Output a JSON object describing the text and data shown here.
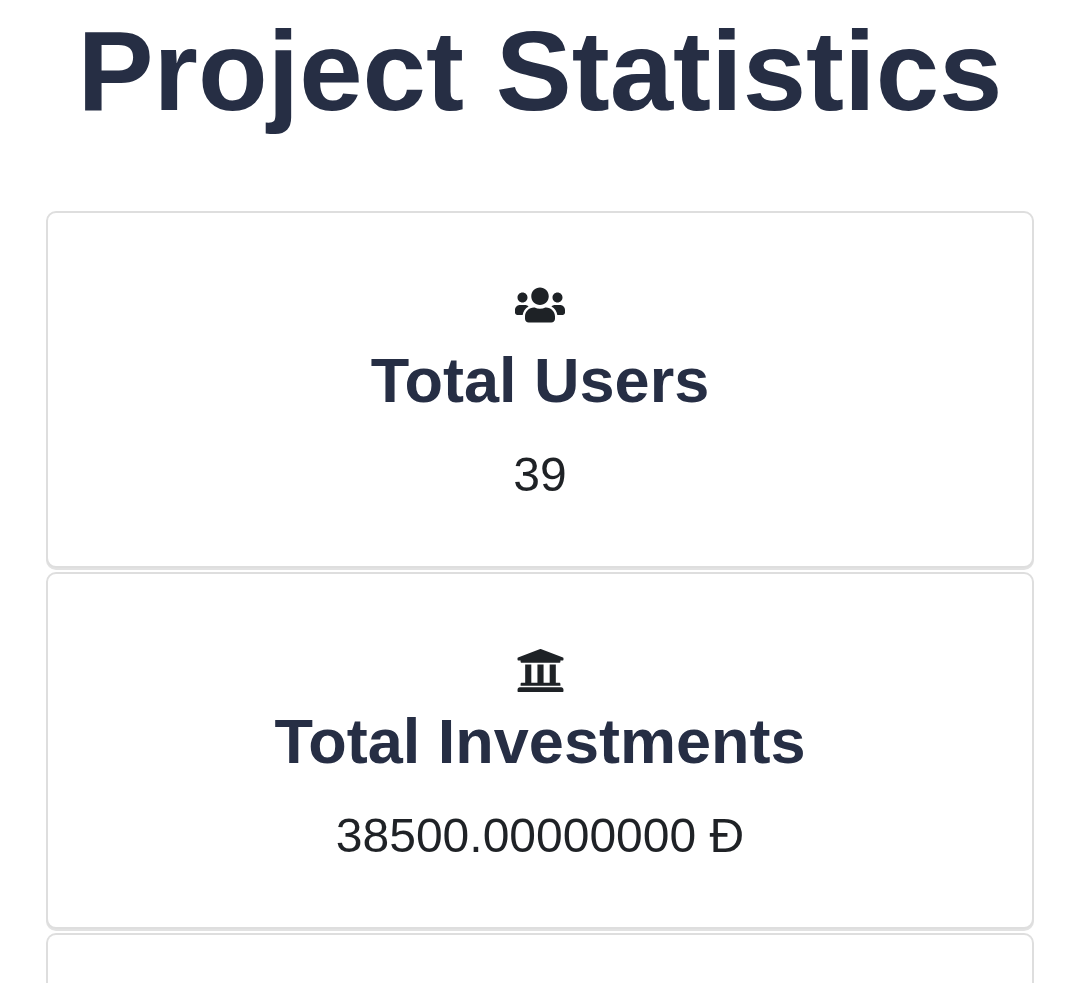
{
  "page": {
    "title": "Project Statistics"
  },
  "stats": [
    {
      "kind": "users",
      "label": "Total Users",
      "value": "39"
    },
    {
      "kind": "investments",
      "label": "Total Investments",
      "value": "38500.00000000 Đ"
    },
    {
      "kind": "cut_off"
    }
  ]
}
